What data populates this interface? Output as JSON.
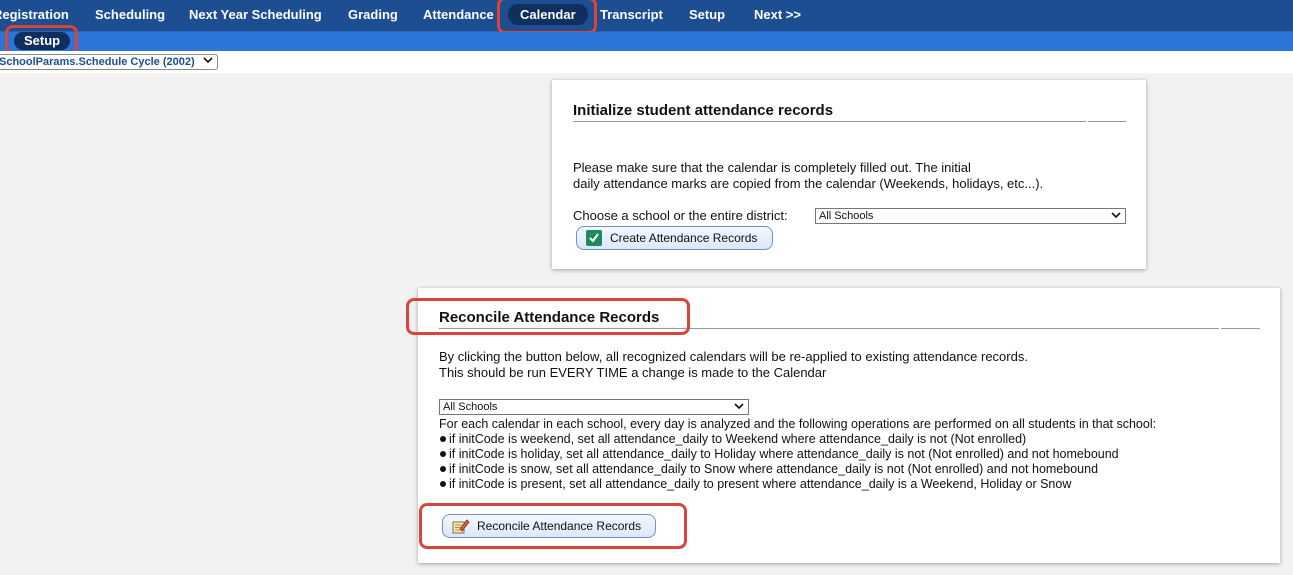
{
  "nav": {
    "tabs": [
      {
        "label": "Registration"
      },
      {
        "label": "Scheduling"
      },
      {
        "label": "Next Year Scheduling"
      },
      {
        "label": "Grading"
      },
      {
        "label": "Attendance"
      },
      {
        "label": "Calendar"
      },
      {
        "label": "Transcript"
      },
      {
        "label": "Setup"
      },
      {
        "label": "Next >>"
      }
    ],
    "active_tab": "Calendar",
    "subtabs": [
      {
        "label": "Setup"
      }
    ]
  },
  "cycle_selector": {
    "value": "SchoolParams.Schedule Cycle (2002)"
  },
  "init_panel": {
    "title": "Initialize student attendance records",
    "line1": "Please make sure that the calendar is completely filled out. The initial",
    "line2": "daily attendance marks are copied from the calendar (Weekends, holidays, etc...).",
    "choose_label": "Choose a school or the entire district:",
    "school_select": "All Schools",
    "button_label": "Create Attendance Records"
  },
  "reconcile_panel": {
    "title": "Reconcile Attendance Records",
    "line1": "By clicking the button below, all recognized calendars will be re-applied to existing attendance records.",
    "line2": "This should be run EVERY TIME a change is made to the Calendar",
    "school_select": "All Schools",
    "description": "For each calendar in each school, every day is analyzed and the following operations are performed on all students in that school:",
    "bullets": [
      "if initCode is weekend, set all attendance_daily to Weekend where attendance_daily is not (Not enrolled)",
      "if initCode is holiday, set all attendance_daily to Holiday where attendance_daily is not (Not enrolled) and not homebound",
      "if initCode is snow, set all attendance_daily to Snow where attendance_daily is not (Not enrolled) and not homebound",
      "if initCode is present, set all attendance_daily to present where attendance_daily is a Weekend, Holiday or Snow"
    ],
    "button_label": "Reconcile Attendance Records"
  },
  "colors": {
    "nav_bg": "#1c4e91",
    "subnav_bg": "#2b75d6",
    "highlight": "#d9453a",
    "check_green": "#1f8a5a"
  },
  "icons": {
    "create_button": "check-icon",
    "reconcile_button": "pencil-icon",
    "dropdown": "chevron-down-icon"
  }
}
